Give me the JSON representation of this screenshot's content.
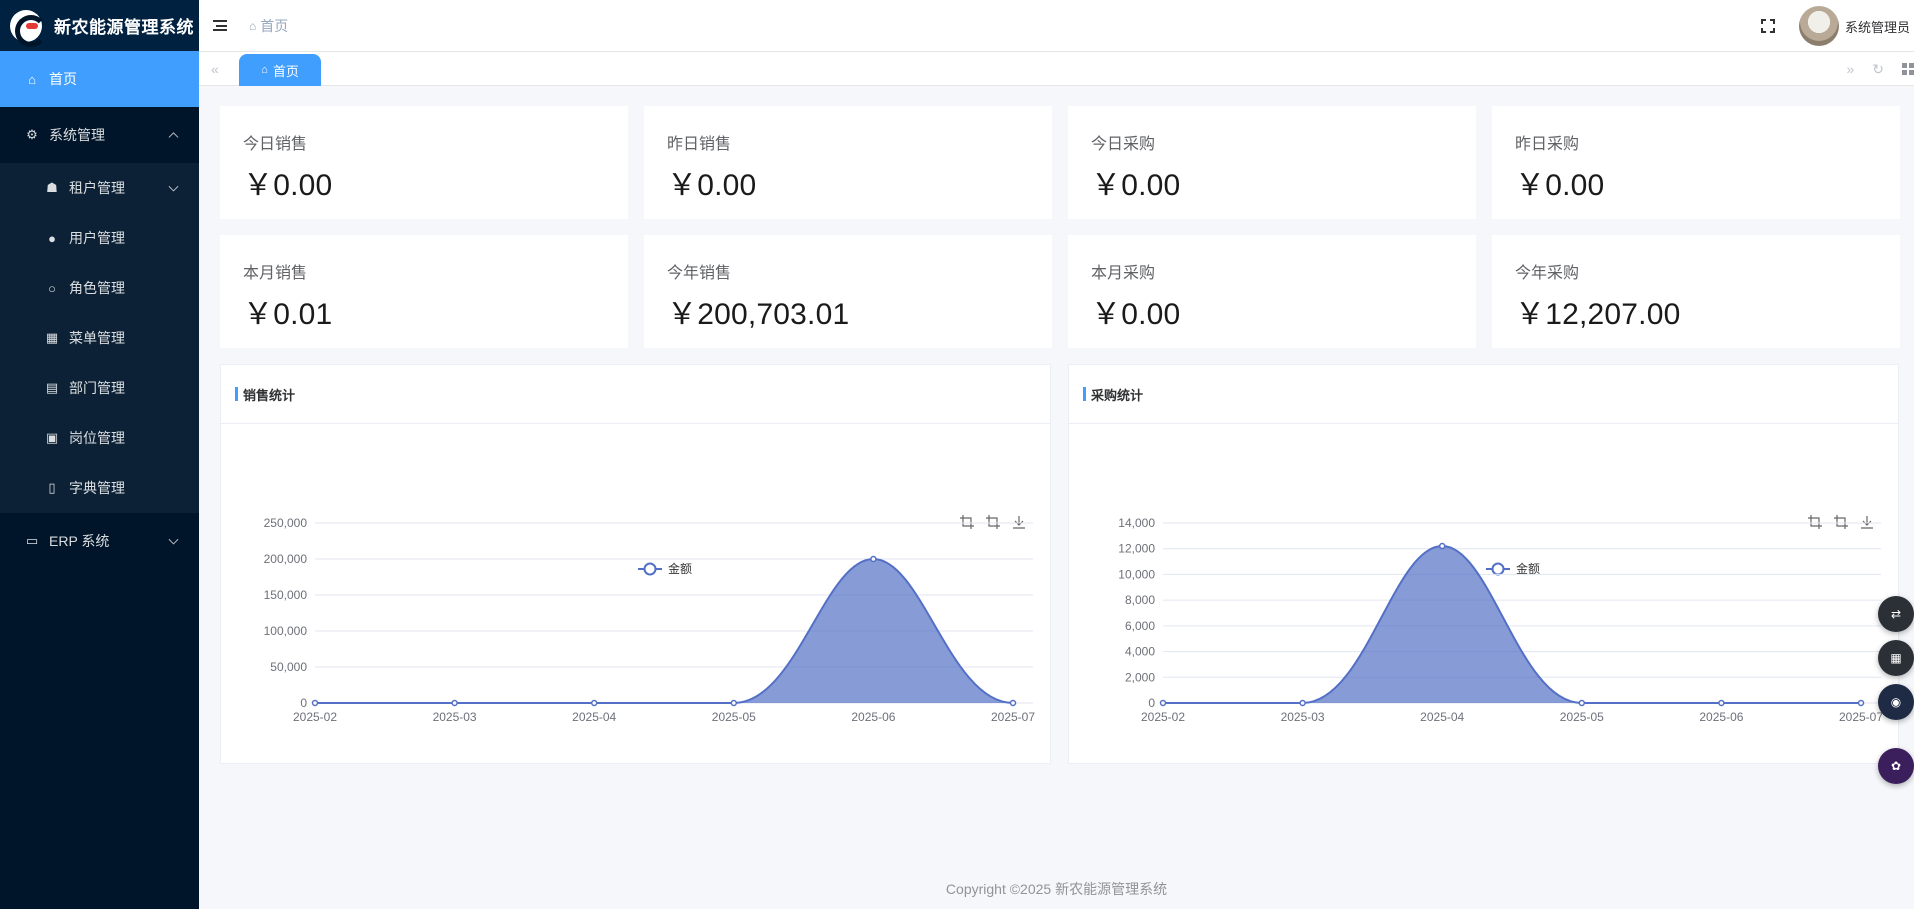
{
  "app": {
    "title": "新农能源管理系统"
  },
  "sidebar": {
    "items": [
      {
        "label": "首页",
        "icon": "home-icon",
        "active": true
      },
      {
        "label": "系统管理",
        "icon": "gear-icon",
        "expanded": true,
        "children": [
          {
            "label": "租户管理",
            "icon": "tenant-icon",
            "has_children": true
          },
          {
            "label": "用户管理",
            "icon": "user-icon"
          },
          {
            "label": "角色管理",
            "icon": "role-icon"
          },
          {
            "label": "菜单管理",
            "icon": "menu-grid-icon"
          },
          {
            "label": "部门管理",
            "icon": "department-icon"
          },
          {
            "label": "岗位管理",
            "icon": "post-icon"
          },
          {
            "label": "字典管理",
            "icon": "dictionary-icon"
          }
        ]
      },
      {
        "label": "ERP 系统",
        "icon": "erp-icon",
        "expanded": false
      }
    ]
  },
  "header": {
    "breadcrumb": "首页",
    "user_name": "系统管理员"
  },
  "tabs": [
    {
      "label": "首页",
      "active": true
    }
  ],
  "stats": [
    {
      "label": "今日销售",
      "value": "￥0.00"
    },
    {
      "label": "昨日销售",
      "value": "￥0.00"
    },
    {
      "label": "今日采购",
      "value": "￥0.00"
    },
    {
      "label": "昨日采购",
      "value": "￥0.00"
    },
    {
      "label": "本月销售",
      "value": "￥0.01"
    },
    {
      "label": "今年销售",
      "value": "￥200,703.01"
    },
    {
      "label": "本月采购",
      "value": "￥0.00"
    },
    {
      "label": "今年采购",
      "value": "￥12,207.00"
    }
  ],
  "panels": {
    "sales_title": "销售统计",
    "purchase_title": "采购统计"
  },
  "colors": {
    "accent": "#409eff",
    "series": "#5470c6",
    "sidebar": "#001529"
  },
  "chart_data": [
    {
      "type": "area",
      "title": "",
      "categories": [
        "2025-02",
        "2025-03",
        "2025-04",
        "2025-05",
        "2025-06",
        "2025-07"
      ],
      "series": [
        {
          "name": "金额",
          "values": [
            0,
            0,
            0,
            0,
            200000,
            0
          ]
        }
      ],
      "ylim": [
        0,
        250000
      ],
      "yticks": [
        "0",
        "50,000",
        "100,000",
        "150,000",
        "200,000",
        "250,000"
      ],
      "legend": "top-center",
      "grid": true
    },
    {
      "type": "area",
      "title": "",
      "categories": [
        "2025-02",
        "2025-03",
        "2025-04",
        "2025-05",
        "2025-06",
        "2025-07"
      ],
      "series": [
        {
          "name": "金额",
          "values": [
            0,
            0,
            12207,
            0,
            0,
            0
          ]
        }
      ],
      "ylim": [
        0,
        14000
      ],
      "yticks": [
        "0",
        "2,000",
        "4,000",
        "6,000",
        "8,000",
        "10,000",
        "12,000",
        "14,000"
      ],
      "legend": "top-center",
      "grid": true
    }
  ],
  "floating": [
    "translate-icon",
    "apps-icon",
    "assistant-icon",
    "brain-icon"
  ],
  "footer": {
    "text": "Copyright ©2025 新农能源管理系统"
  }
}
